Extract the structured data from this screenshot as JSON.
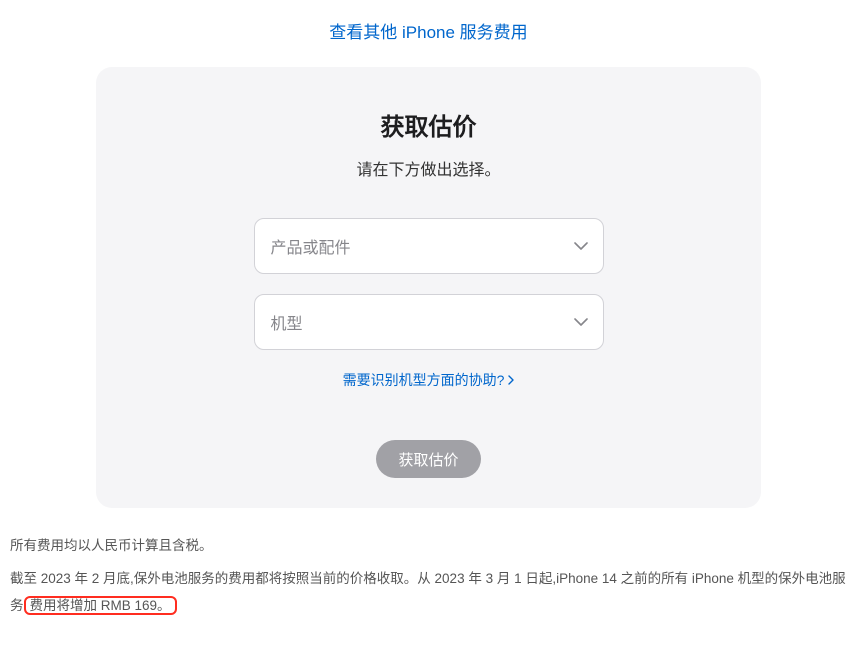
{
  "topLink": {
    "label": "查看其他 iPhone 服务费用"
  },
  "card": {
    "title": "获取估价",
    "subtitle": "请在下方做出选择。",
    "productSelect": {
      "placeholder": "产品或配件"
    },
    "modelSelect": {
      "placeholder": "机型"
    },
    "helpLink": {
      "label": "需要识别机型方面的协助?"
    },
    "submitButton": {
      "label": "获取估价"
    }
  },
  "footer": {
    "line1": "所有费用均以人民币计算且含税。",
    "line2_part1": "截至 2023 年 2 月底,保外电池服务的费用都将按照当前的价格收取。从 2023 年 3 月 1 日起,iPhone 14 之前的所有 iPhone 机型的保外电池服",
    "line2_part2_prefix": "务",
    "line2_annotated": "费用将增加 RMB 169。"
  }
}
